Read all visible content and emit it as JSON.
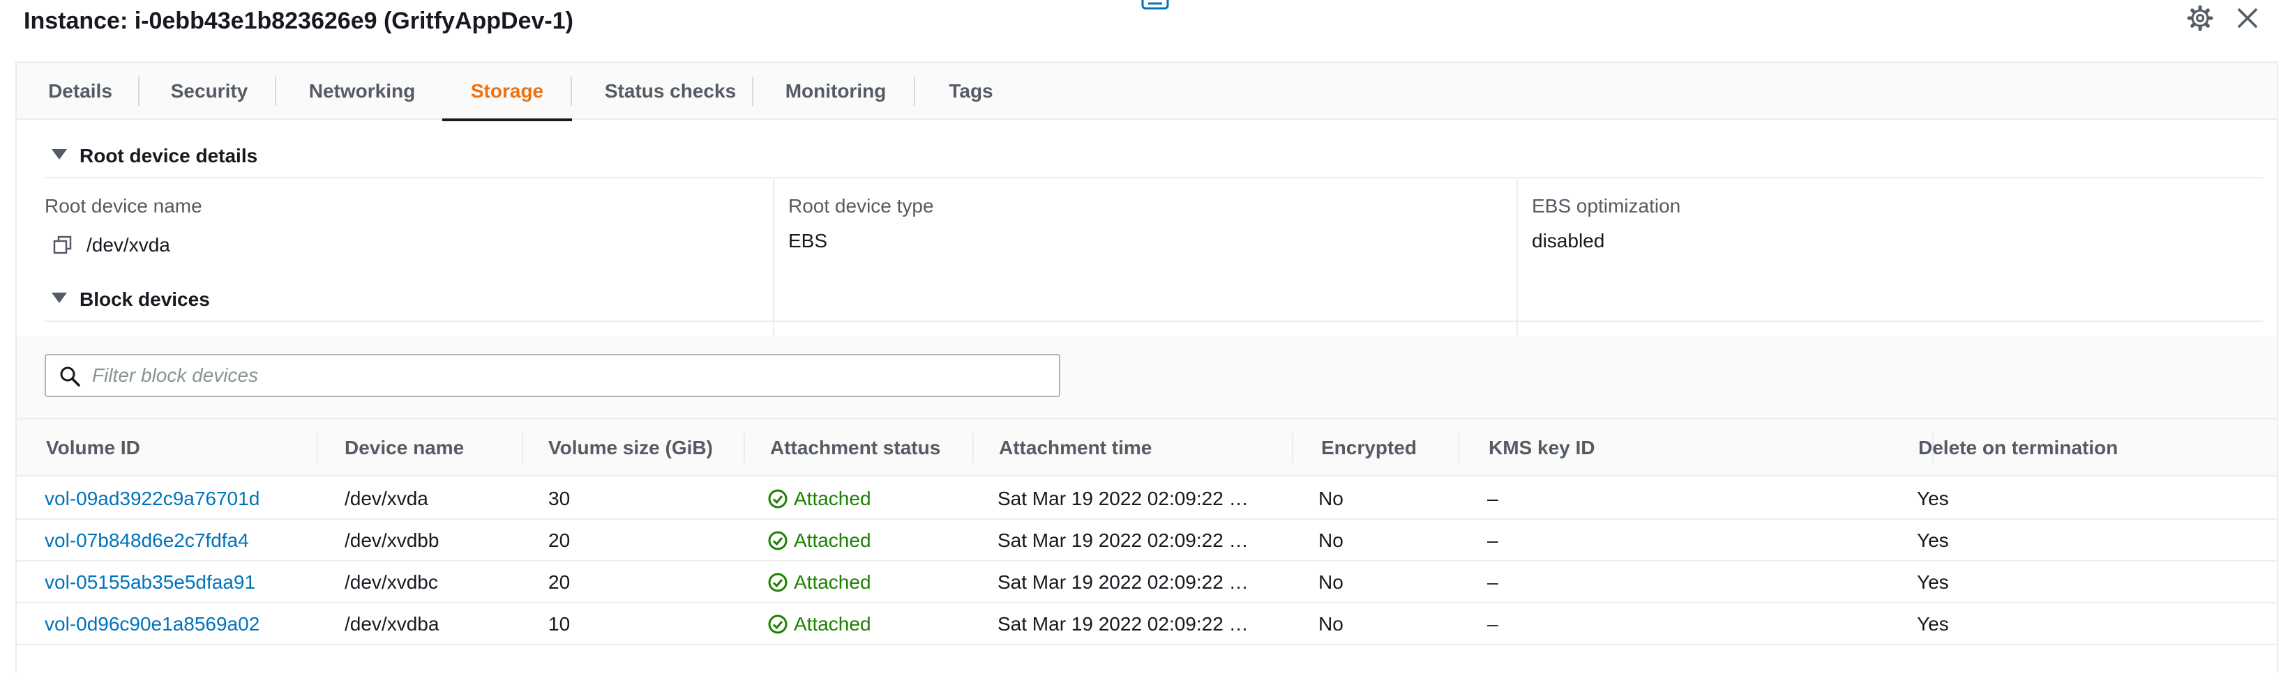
{
  "header": {
    "title": "Instance: i-0ebb43e1b823626e9 (GritfyAppDev-1)"
  },
  "tabs": [
    {
      "label": "Details"
    },
    {
      "label": "Security"
    },
    {
      "label": "Networking"
    },
    {
      "label": "Storage",
      "active": true
    },
    {
      "label": "Status checks"
    },
    {
      "label": "Monitoring"
    },
    {
      "label": "Tags"
    }
  ],
  "root_device": {
    "section_title": "Root device details",
    "name_label": "Root device name",
    "name_value": "/dev/xvda",
    "type_label": "Root device type",
    "type_value": "EBS",
    "ebs_opt_label": "EBS optimization",
    "ebs_opt_value": "disabled"
  },
  "block_devices": {
    "section_title": "Block devices",
    "filter_placeholder": "Filter block devices",
    "columns": [
      "Volume ID",
      "Device name",
      "Volume size (GiB)",
      "Attachment status",
      "Attachment time",
      "Encrypted",
      "KMS key ID",
      "Delete on termination"
    ],
    "rows": [
      {
        "volume_id": "vol-09ad3922c9a76701d",
        "device": "/dev/xvda",
        "size": "30",
        "status": "Attached",
        "time": "Sat Mar 19 2022 02:09:22 …",
        "encrypted": "No",
        "kms": "–",
        "delete": "Yes"
      },
      {
        "volume_id": "vol-07b848d6e2c7fdfa4",
        "device": "/dev/xvdbb",
        "size": "20",
        "status": "Attached",
        "time": "Sat Mar 19 2022 02:09:22 …",
        "encrypted": "No",
        "kms": "–",
        "delete": "Yes"
      },
      {
        "volume_id": "vol-05155ab35e5dfaa91",
        "device": "/dev/xvdbc",
        "size": "20",
        "status": "Attached",
        "time": "Sat Mar 19 2022 02:09:22 …",
        "encrypted": "No",
        "kms": "–",
        "delete": "Yes"
      },
      {
        "volume_id": "vol-0d96c90e1a8569a02",
        "device": "/dev/xvdba",
        "size": "10",
        "status": "Attached",
        "time": "Sat Mar 19 2022 02:09:22 …",
        "encrypted": "No",
        "kms": "–",
        "delete": "Yes"
      }
    ]
  },
  "colors": {
    "accent": "#ec7211",
    "link": "#0073bb",
    "success": "#1d8102"
  },
  "icons": [
    "gear-icon",
    "close-icon",
    "copy-icon",
    "search-icon",
    "status-success-icon",
    "caret-down-icon"
  ]
}
